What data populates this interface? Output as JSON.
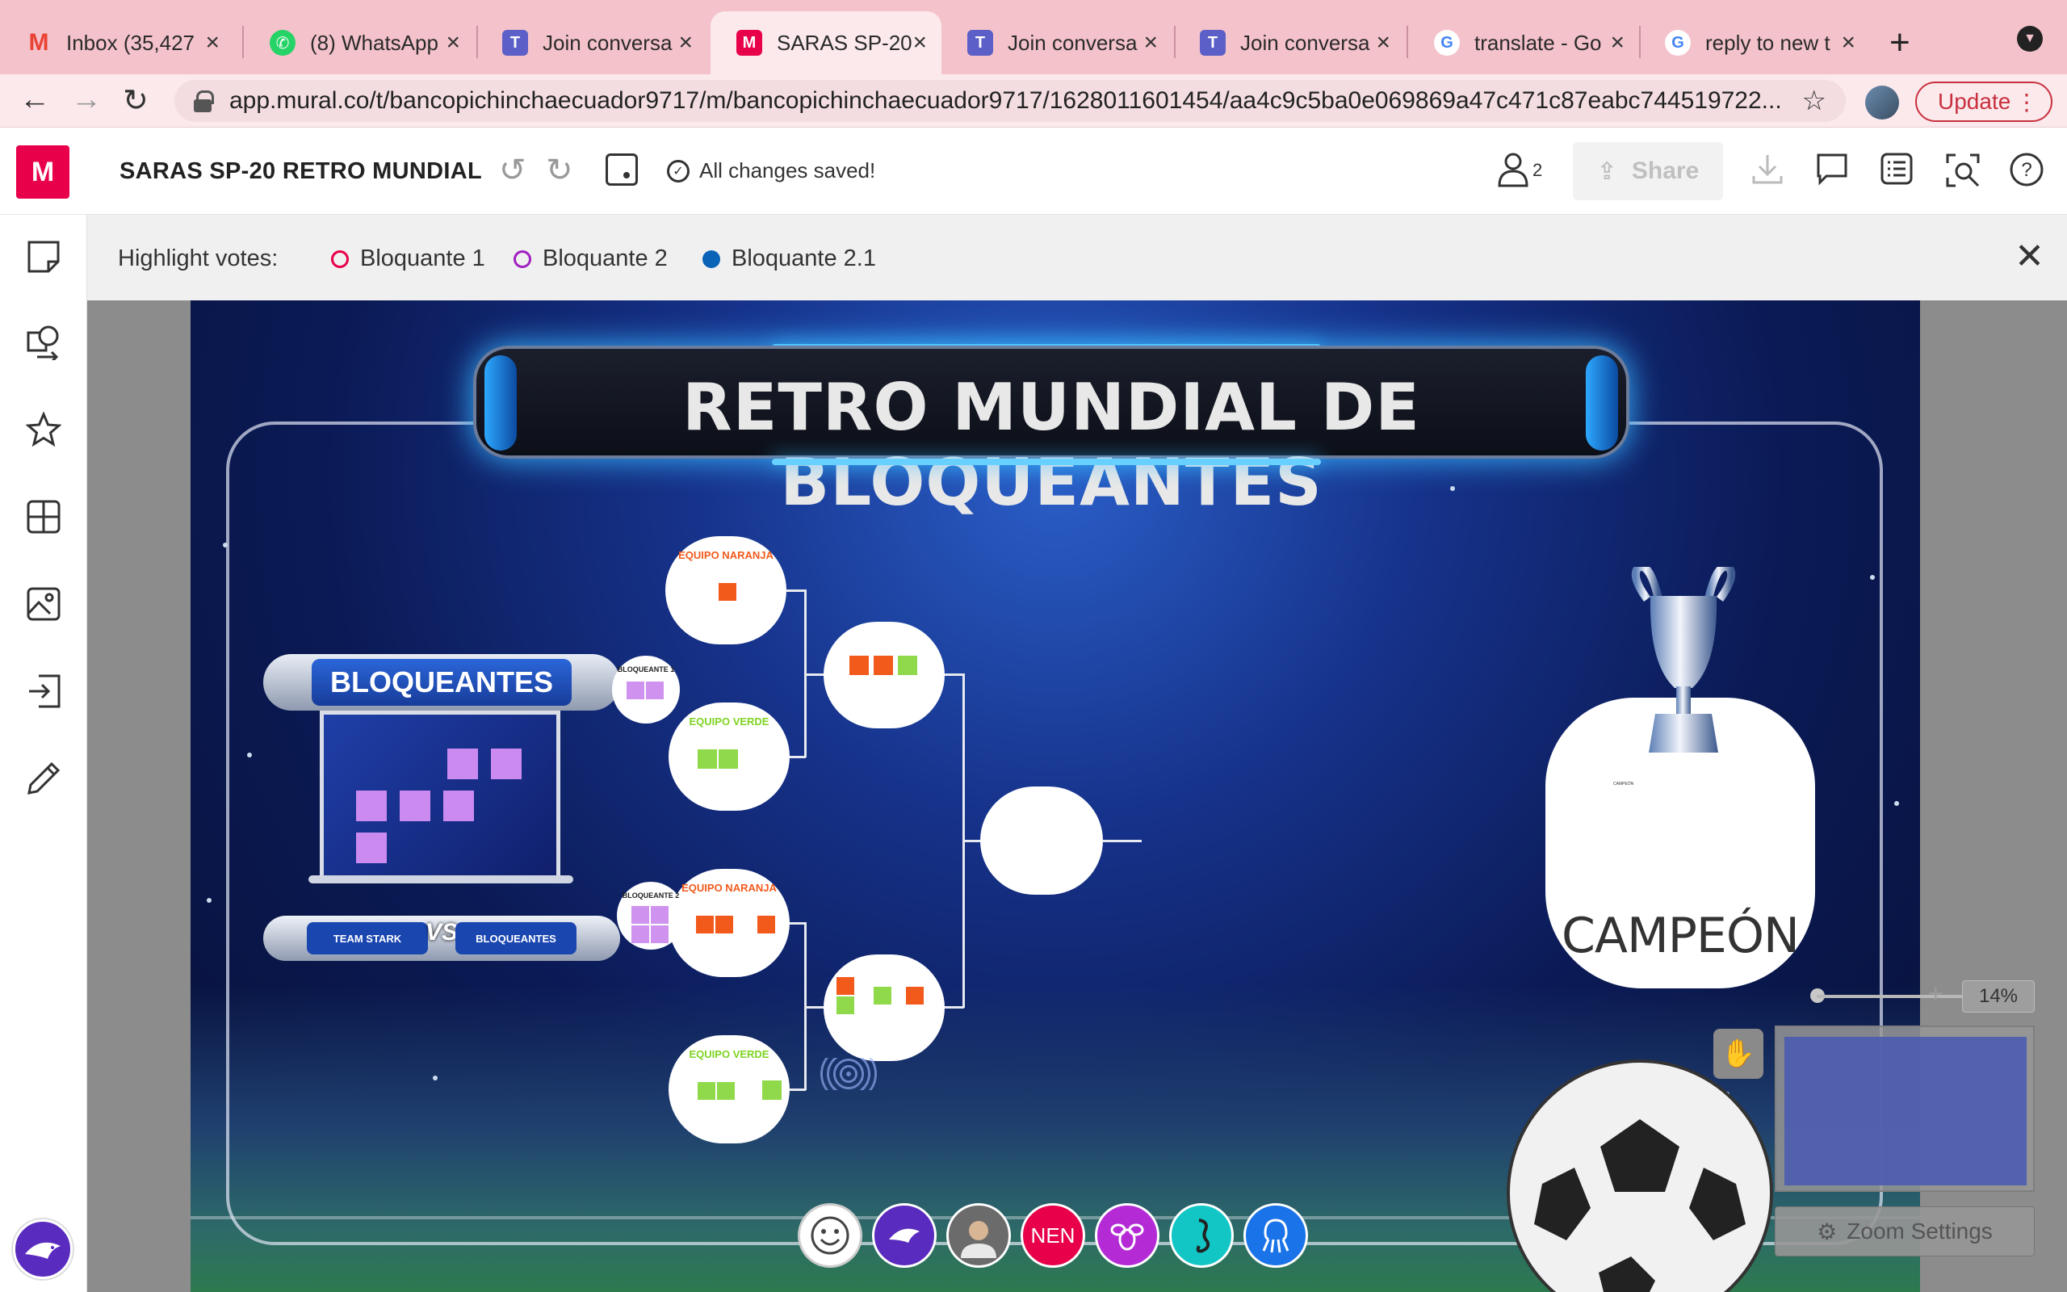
{
  "browser": {
    "tabs": [
      {
        "title": "Inbox (35,427",
        "favicon": "gmail-icon",
        "color": "#ea4335"
      },
      {
        "title": "(8) WhatsApp",
        "favicon": "whatsapp-icon",
        "color": "#25d366"
      },
      {
        "title": "Join conversa",
        "favicon": "teams-icon",
        "color": "#5b5fc7"
      },
      {
        "title": "SARAS SP-20",
        "favicon": "mural-icon",
        "color": "#e8004a"
      },
      {
        "title": "Join conversa",
        "favicon": "teams-icon",
        "color": "#5b5fc7"
      },
      {
        "title": "Join conversa",
        "favicon": "teams-icon",
        "color": "#5b5fc7"
      },
      {
        "title": "translate - Go",
        "favicon": "google-icon",
        "color": "#4285f4"
      },
      {
        "title": "reply to new t",
        "favicon": "google-icon",
        "color": "#4285f4"
      }
    ],
    "url": "app.mural.co/t/bancopichinchaecuador9717/m/bancopichinchaecuador9717/1628011601454/aa4c9c5ba0e069869a47c471c87eabc744519722...",
    "update_label": "Update"
  },
  "app": {
    "logo": "M",
    "title": "SARAS SP-20 RETRO MUNDIAL",
    "save_status": "All changes saved!",
    "collaborators": "2",
    "share_label": "Share"
  },
  "votes": {
    "label": "Highlight votes:",
    "items": [
      {
        "label": "Bloquante 1",
        "color": "#e8004a",
        "filled": false
      },
      {
        "label": "Bloquante 2",
        "color": "#a020c0",
        "filled": false
      },
      {
        "label": "Bloquante 2.1",
        "color": "#0b63b8",
        "filled": true
      }
    ]
  },
  "board": {
    "title": "RETRO MUNDIAL DE BLOQUEANTES",
    "scoreboard_title": "BLOQUEANTES",
    "team_left": "TEAM STARK",
    "vs": "VS",
    "team_right": "BLOQUEANTES",
    "bloqueante_1": "BLOQUEANTE 1",
    "bloqueante_2": "BLOQUEANTE 2",
    "equipo_naranja": "EQUIPO NARANJA",
    "equipo_verde": "EQUIPO VERDE",
    "champion_label": "CAMPEÓN",
    "champion_small": "CAMPEÓN"
  },
  "zoom": {
    "percent": "14%",
    "settings_label": "Zoom Settings"
  },
  "avatars": [
    {
      "name": "smiley-avatar",
      "text": "",
      "color": "#ffffff"
    },
    {
      "name": "shark-avatar",
      "text": "",
      "color": "#5a2bbf"
    },
    {
      "name": "user-photo-avatar",
      "text": "",
      "color": "#6b6b6b"
    },
    {
      "name": "nen-avatar",
      "text": "NEN",
      "color": "#e8004a"
    },
    {
      "name": "bee-avatar",
      "text": "",
      "color": "#b42bd6"
    },
    {
      "name": "seahorse-avatar",
      "text": "",
      "color": "#13c6c6"
    },
    {
      "name": "octopus-avatar",
      "text": "",
      "color": "#1a73e8"
    }
  ]
}
